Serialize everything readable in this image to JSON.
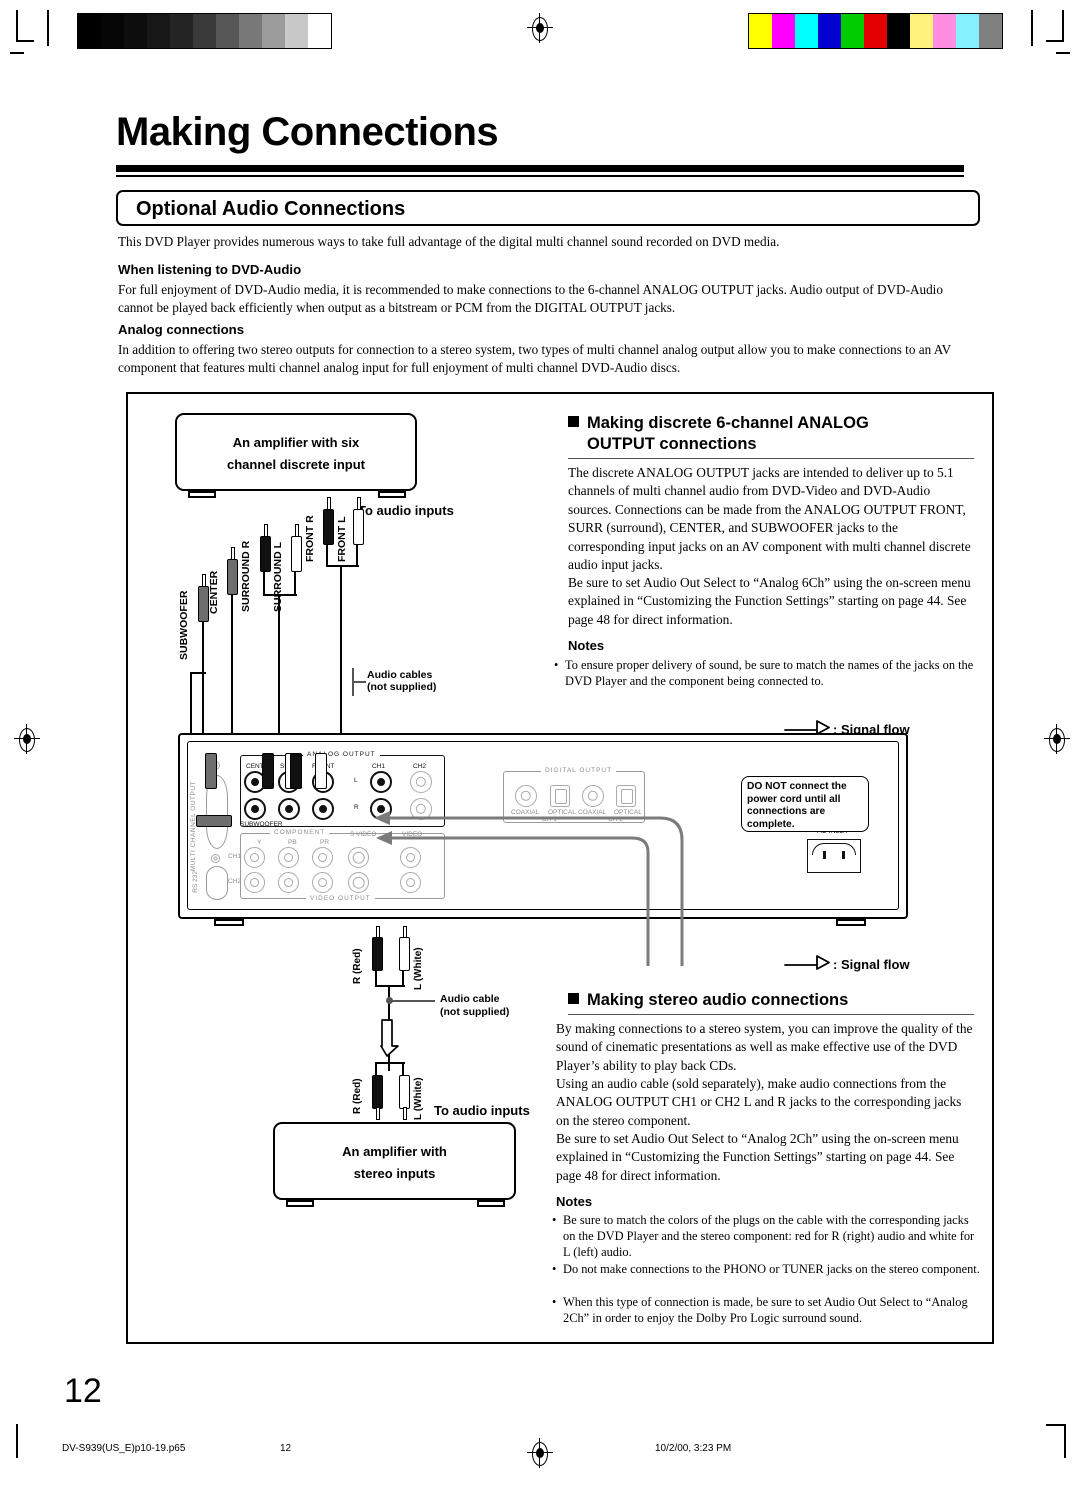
{
  "document": {
    "chapter_title": "Making Connections",
    "section_title": "Optional Audio Connections",
    "page_number": "12"
  },
  "intro": {
    "paragraph": "This DVD Player provides numerous ways to take full advantage of the digital multi channel sound recorded on DVD media."
  },
  "dvd_audio": {
    "heading": "When listening to DVD-Audio",
    "paragraph": "For full enjoyment of DVD-Audio media, it is recommended to make connections to the 6-channel ANALOG OUTPUT jacks. Audio output of DVD-Audio cannot be played back efficiently when output as a bitstream or PCM from the DIGITAL OUTPUT jacks."
  },
  "analog": {
    "heading": "Analog connections",
    "paragraph": "In addition to offering two stereo outputs for connection to a stereo system, two types of multi channel analog output allow you to make connections to an AV component that features multi channel analog input for full enjoyment of multi channel DVD-Audio discs."
  },
  "six_channel": {
    "heading_line1": "Making discrete 6-channel ANALOG",
    "heading_line2": "OUTPUT connections",
    "body": "The discrete ANALOG OUTPUT jacks are intended to deliver up to 5.1 channels of multi channel audio from DVD-Video and DVD-Audio sources. Connections can be made from the ANALOG OUTPUT FRONT, SURR (surround), CENTER, and SUBWOOFER jacks to the corresponding input jacks on an AV component with multi channel discrete audio input jacks.",
    "body2": "Be sure to set Audio Out Select to “Analog 6Ch” using the on-screen menu explained in “Customizing the Function Settings” starting on page 44. See page 48 for direct information.",
    "notes_label": "Notes",
    "notes": [
      "To ensure proper delivery of sound, be sure to match the names of the jacks on the DVD Player and the component being connected to."
    ]
  },
  "stereo": {
    "heading": "Making stereo audio connections",
    "body": "By making connections to a stereo system, you can improve the quality of the sound of cinematic presentations as well as make effective use of the DVD Player’s ability to play back CDs.",
    "body2": "Using an audio cable (sold separately), make audio connections from the ANALOG OUTPUT CH1 or CH2 L and R jacks to the corresponding jacks on the stereo component.",
    "body3": "Be sure to set Audio Out Select to “Analog 2Ch” using the on-screen menu explained in “Customizing the Function Settings” starting on page 44. See page 48 for direct information.",
    "notes_label": "Notes",
    "notes": [
      "Be sure to match the colors of the plugs on the cable with the corresponding jacks on the DVD Player and the stereo component: red for R (right) audio and white for L (left) audio.",
      "Do not make connections to the PHONO or TUNER jacks on the stereo component.",
      "When this type of connection is made, be sure to set Audio Out Select to “Analog 2Ch” in order to enjoy the Dolby Pro Logic surround sound."
    ]
  },
  "diagram": {
    "amp_six": {
      "line1": "An amplifier with six",
      "line2": "channel discrete input"
    },
    "amp_stereo": {
      "line1": "An amplifier with",
      "line2": "stereo inputs"
    },
    "to_audio_inputs_top": "To audio inputs",
    "to_audio_inputs_bottom": "To audio inputs",
    "audio_cables_label_line1": "Audio cables",
    "audio_cables_label_line2": "(not supplied)",
    "audio_cable_label_line1": "Audio cable",
    "audio_cable_label_line2": "(not supplied)",
    "channel_labels": [
      "SUBWOOFER",
      "CENTER",
      "SURROUND R",
      "SURROUND L",
      "FRONT R",
      "FRONT L"
    ],
    "stereo_plug_labels": {
      "right": "R (Red)",
      "left": "L (White)"
    },
    "signal_flow_top": ": Signal flow",
    "signal_flow_bottom": ": Signal flow",
    "warning": "DO NOT connect the power cord until all connections are complete.",
    "rear_panel": {
      "analog_output_title": "ANALOG  OUTPUT",
      "digital_output_title": "DIGITAL  OUTPUT",
      "video_output_title": "VIDEO  OUTPUT",
      "component_title": "COMPONENT",
      "multi_channel_output": "MULTI CHANNEL OUTPUT",
      "rs232": "RS 232",
      "ac_inlet": "AC INLET",
      "analog_jacks": [
        "CENTER",
        "SURR",
        "FRONT",
        "CH1",
        "CH2"
      ],
      "analog_rows": [
        "L",
        "R"
      ],
      "subwoofer_label": "SUBWOOFER",
      "digital_jacks": [
        "COAXIAL",
        "OPTICAL",
        "COAXIAL",
        "OPTICAL"
      ],
      "digital_channels": [
        "CH 1",
        "CH 2"
      ],
      "component_jacks": [
        "Y",
        "PB",
        "PR"
      ],
      "video_rows": [
        "CH1",
        "CH2"
      ],
      "svideo_label": "S VIDEO",
      "video_label": "VIDEO"
    }
  },
  "footer": {
    "filename": "DV-S939(US_E)p10-19.p65",
    "page": "12",
    "timestamp": "10/2/00, 3:23 PM"
  },
  "registration": {
    "gray_steps": [
      "#000000",
      "#050505",
      "#0d0d0d",
      "#171717",
      "#242424",
      "#3a3a3a",
      "#575757",
      "#787878",
      "#9c9c9c",
      "#c8c8c8",
      "#ffffff"
    ],
    "color_steps": [
      "#ffff00",
      "#ff00ff",
      "#00ffff",
      "#0000d0",
      "#00cc00",
      "#e40000",
      "#000000",
      "#fff27a",
      "#ff8fe0",
      "#85f0ff",
      "#808080"
    ]
  }
}
